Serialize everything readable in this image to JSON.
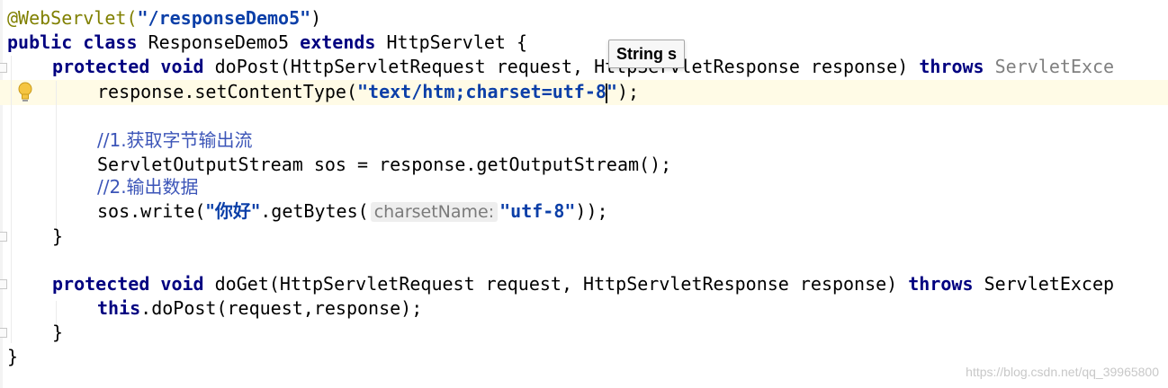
{
  "code": {
    "annotation": "@WebServlet(",
    "annotation_value": "\"/responseDemo5\"",
    "annotation_close": ")",
    "kw_public": "public",
    "kw_class": "class",
    "class_name": "ResponseDemo5",
    "kw_extends": "extends",
    "super_class": "HttpServlet {",
    "kw_protected": "protected",
    "kw_void": "void",
    "dopost_sig_a": "doPost(HttpServletRequest request, ",
    "dopost_sig_obscured": "HttpServletResponse response",
    "dopost_sig_b": ") ",
    "kw_throws": "throws",
    "dopost_exception": "ServletExce",
    "set_content_type": "response.setContentType(",
    "content_type_a": "\"text/htm",
    "content_type_b": ";charset=utf-8",
    "content_type_c": "\"",
    "set_content_type_close": ");",
    "comment1": "//1.获取字节输出流",
    "sos_line": "ServletOutputStream sos = response.getOutputStream();",
    "comment2": "//2.输出数据",
    "write_a": "sos.write(",
    "write_str": "\"你好\"",
    "write_b": ".getBytes(",
    "hint_label": "charsetName:",
    "write_charset": "\"utf-8\"",
    "write_close": "));",
    "close_brace_1": "}",
    "doget_sig": "doGet(HttpServletRequest request, HttpServletResponse response) ",
    "doget_exception": "ServletExcep",
    "kw_this": "this",
    "this_call": ".doPost(request,response);",
    "close_brace_2": "}",
    "close_brace_3": "}"
  },
  "tooltip": {
    "text": "String s"
  },
  "icons": {
    "lightbulb": "lightbulb-icon"
  },
  "watermark": "https://blog.csdn.net/qq_39965800",
  "colors": {
    "keyword": "#000080",
    "string": "#0b3fa8",
    "annotation": "#808000",
    "comment": "#3c55b8",
    "highlight_line": "#fffbe6"
  }
}
